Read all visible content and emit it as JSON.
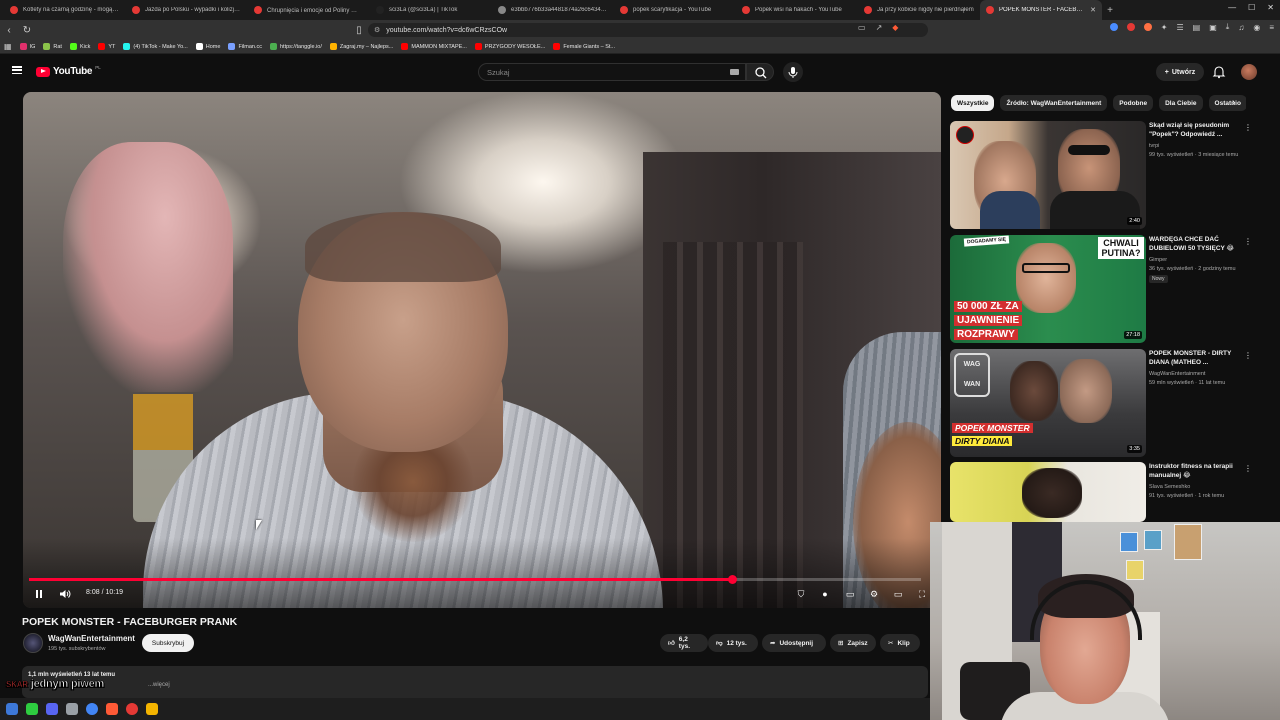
{
  "browser": {
    "tabs": [
      {
        "label": "Kotlety na czarną godzinę - mogą ul..."
      },
      {
        "label": "Jazda po Polsku - wypadki i kolizje o..."
      },
      {
        "label": "Chrupnięcia i emocje od Poliny 😂 -..."
      },
      {
        "label": "sci3La (@sci3La) | TikTok"
      },
      {
        "label": "e3bbb776b33a4481874a26c64347b..."
      },
      {
        "label": "popek scaryfikacja - YouTube"
      },
      {
        "label": "Popek wisi na hakach - YouTube"
      },
      {
        "label": "Ja przy kobicie nigdy nie pierdnąłem"
      },
      {
        "label": "POPEK MONSTER - FACEBURG..."
      }
    ],
    "active_tab_index": 8,
    "url": "youtube.com/watch?v=dc6wCRzsCOw",
    "bookmarks": [
      {
        "label": "IG",
        "color": "#e1306c"
      },
      {
        "label": "Rat",
        "color": "#8bc34a"
      },
      {
        "label": "Kick",
        "color": "#53fc18"
      },
      {
        "label": "YT",
        "color": "#ff0000"
      },
      {
        "label": "(4) TikTok - Make Yo...",
        "color": "#25f4ee"
      },
      {
        "label": "Home",
        "color": "#ffffff"
      },
      {
        "label": "Filman.cc",
        "color": "#7aa0ff"
      },
      {
        "label": "https://tanggle.io/",
        "color": "#4caf50"
      },
      {
        "label": "Zagraj.my – Najleps...",
        "color": "#ffb300"
      },
      {
        "label": "MAMMON MIXTAPE...",
        "color": "#ff0000"
      },
      {
        "label": "PRZYGODY WESOŁE...",
        "color": "#ff0000"
      },
      {
        "label": "Female Giants – St...",
        "color": "#ff0000"
      }
    ]
  },
  "youtube": {
    "logo_text": "YouTube",
    "country_code": "PL",
    "search_placeholder": "Szukaj",
    "create_label": "Utwórz"
  },
  "player": {
    "current_time": "8:08",
    "duration": "10:19",
    "time_display": "8:08 / 10:19",
    "progress_fraction": 0.788
  },
  "video": {
    "title": "POPEK MONSTER - FACEBURGER PRANK",
    "channel": "WagWanEntertainment",
    "subscribers": "195 tys. subskrybentów",
    "subscribe_label": "Subskrybuj",
    "likes": "6,2 tys.",
    "dislikes": "12 tys.",
    "share_label": "Udostępnij",
    "save_label": "Zapisz",
    "clip_label": "Klip",
    "views_age": "1,1 mln wyświetleń  13 lat temu",
    "more_label": "...więcej"
  },
  "overlay": {
    "caption": "jednym piwem",
    "red_text": "SKAR"
  },
  "sidebar": {
    "chips": [
      {
        "label": "Wszystkie",
        "active": true
      },
      {
        "label": "Źródło: WagWanEntertainment",
        "active": false
      },
      {
        "label": "Podobne",
        "active": false
      },
      {
        "label": "Dla Ciebie",
        "active": false
      },
      {
        "label": "Ostatnio",
        "active": false
      }
    ],
    "recommendations": [
      {
        "title": "Skąd wziął się pseudonim \"Popek\"? Odpowiedź ...",
        "channel": "tvrpi",
        "meta": "99 tys. wyświetleń · 3 miesiące temu",
        "duration": "2:40",
        "badge": ""
      },
      {
        "title": "WARDĘGA CHCE DAĆ DUBIELOWI 50 TYSIĘCY 😂",
        "channel": "Gimper",
        "meta": "36 tys. wyświetleń · 2 godziny temu",
        "duration": "27:18",
        "badge": "Nowy"
      },
      {
        "title": "POPEK MONSTER - DIRTY DIANA (MATHEO ...",
        "channel": "WagWanEntertainment",
        "meta": "59 mln wyświetleń · 11 lat temu",
        "duration": "3:35",
        "badge": ""
      },
      {
        "title": "Instruktor fitness na terapii manualnej 😂",
        "channel": "Slava Semeshko",
        "meta": "91 tys. wyświetleń · 1 rok temu",
        "duration": "",
        "badge": ""
      }
    ],
    "thumb_texts": {
      "t2_top": "DOGADAMY SIĘ",
      "t2_right": "CHWALI PUTINA?",
      "t2_bottom1": "50 000 ZŁ ZA",
      "t2_bottom2": "UJAWNIENIE",
      "t2_bottom3": "ROZPRAWY",
      "t3_line1": "POPEK MONSTER",
      "t3_line2": "DIRTY DIANA",
      "t3_logo": "WAG WAN"
    }
  }
}
